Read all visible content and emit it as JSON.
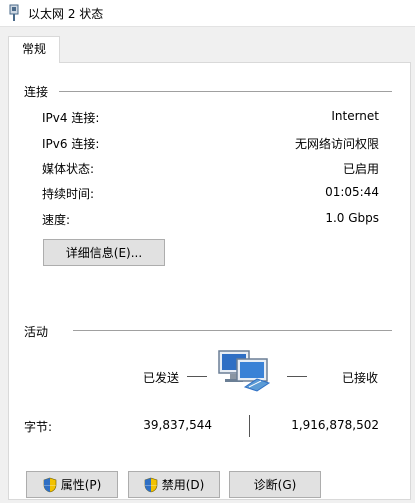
{
  "window": {
    "title": "以太网 2 状态"
  },
  "tabs": [
    {
      "label": "常规"
    }
  ],
  "connection": {
    "section_label": "连接",
    "rows": [
      {
        "label": "IPv4 连接:",
        "value": "Internet"
      },
      {
        "label": "IPv6 连接:",
        "value": "无网络访问权限"
      },
      {
        "label": "媒体状态:",
        "value": "已启用"
      },
      {
        "label": "持续时间:",
        "value": "01:05:44"
      },
      {
        "label": "速度:",
        "value": "1.0 Gbps"
      }
    ],
    "details_button": "详细信息(E)..."
  },
  "activity": {
    "section_label": "活动",
    "sent_label": "已发送",
    "received_label": "已接收",
    "bytes_label": "字节:",
    "bytes_sent": "39,837,544",
    "bytes_received": "1,916,878,502"
  },
  "buttons": {
    "properties": "属性(P)",
    "disable": "禁用(D)",
    "diagnose": "诊断(G)"
  },
  "icons": {
    "title": "network-adapter-icon",
    "activity": "network-computers-icon",
    "shield": "uac-shield-icon"
  },
  "colors": {
    "background": "#f0f0f0",
    "panel": "#ffffff",
    "button": "#e1e1e1"
  }
}
